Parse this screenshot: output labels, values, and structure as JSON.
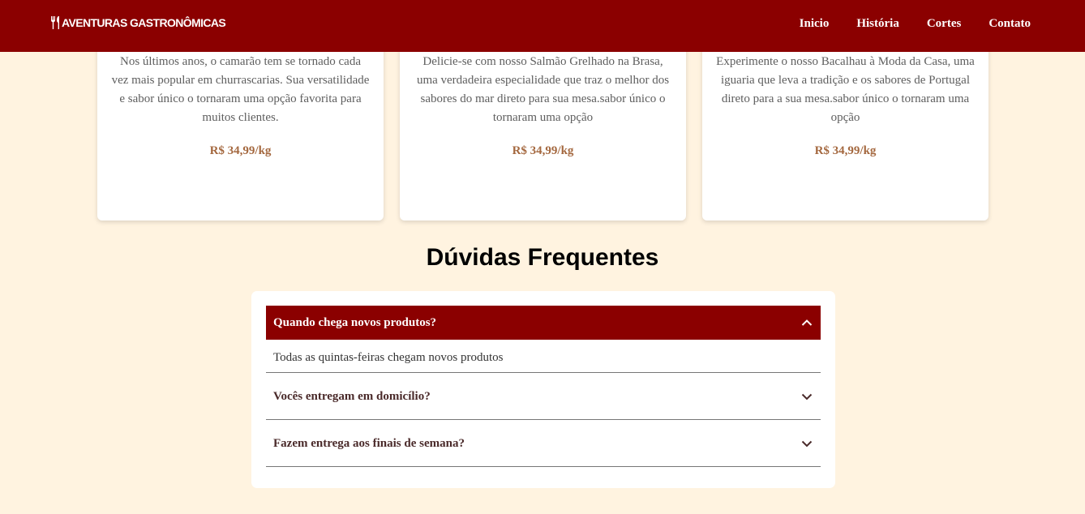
{
  "brand": {
    "name": "AVENTURAS GASTRONÔMICAS",
    "icon": "fork-knife-icon"
  },
  "nav": {
    "items": [
      "Inicio",
      "História",
      "Cortes",
      "Contato"
    ]
  },
  "colors": {
    "primary": "#8b0000",
    "background": "#fff3e0",
    "price": "#a4683f"
  },
  "cards": [
    {
      "text": "Nos últimos anos, o camarão tem se tornado cada vez mais popular em churrascarias. Sua versatilidade e sabor único o tornaram uma opção favorita para muitos clientes.",
      "price": "R$ 34,99/kg"
    },
    {
      "text": "Delicie-se com nosso Salmão Grelhado na Brasa, uma verdadeira especialidade que traz o melhor dos sabores do mar direto para sua mesa.sabor único o tornaram uma opção",
      "price": "R$ 34,99/kg"
    },
    {
      "text": "Experimente o nosso Bacalhau à Moda da Casa, uma iguaria que leva a tradição e os sabores de Portugal direto para a sua mesa.sabor único o tornaram uma opção",
      "price": "R$ 34,99/kg"
    }
  ],
  "faq": {
    "title": "Dúvidas Frequentes",
    "items": [
      {
        "question": "Quando chega novos produtos?",
        "answer": "Todas as quintas-feiras chegam novos produtos",
        "expanded": true,
        "icon": "chevron-up-icon"
      },
      {
        "question": "Vocês entregam em domicílio?",
        "expanded": false,
        "icon": "chevron-down-icon"
      },
      {
        "question": "Fazem entrega aos finais de semana?",
        "expanded": false,
        "icon": "chevron-down-icon"
      }
    ]
  }
}
